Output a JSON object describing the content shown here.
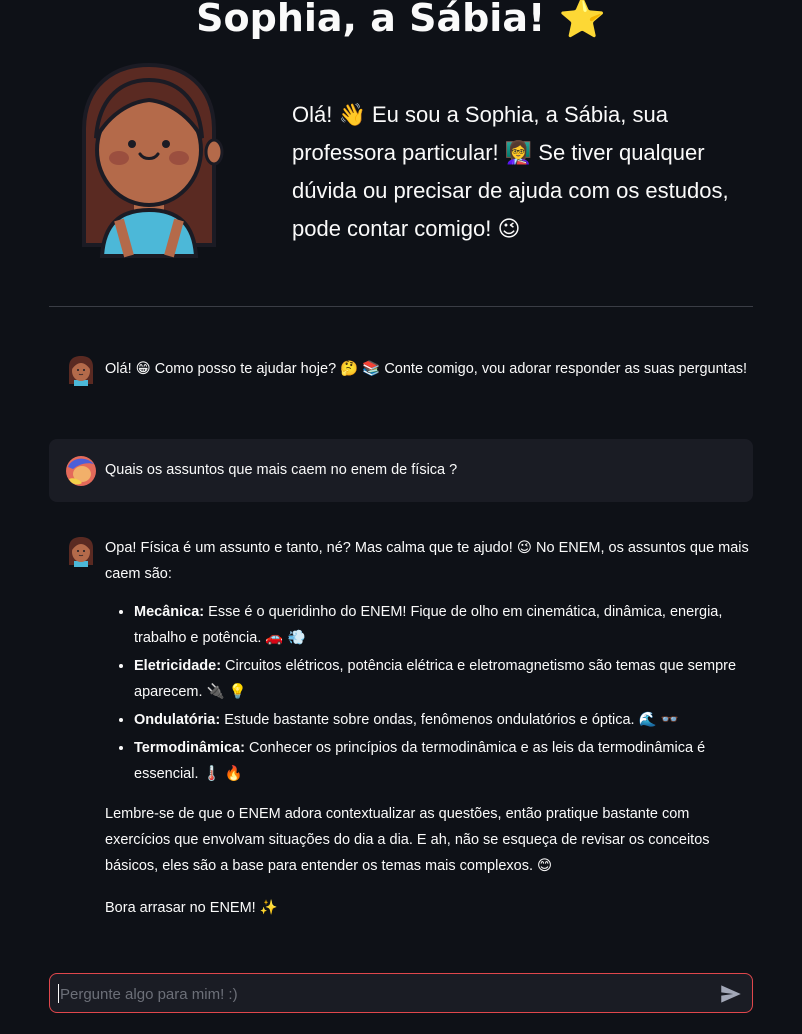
{
  "app": {
    "title": "Sophia, a Sábia! ⭐"
  },
  "intro": {
    "text": "Olá! 👋 Eu sou a Sophia, a Sábia, sua professora particular! 👩‍🏫 Se tiver qualquer dúvida ou precisar de ajuda com os estudos, pode contar comigo! 😉"
  },
  "chat": {
    "messages": [
      {
        "role": "assistant",
        "text": "Olá! 😁 Como posso te ajudar hoje? 🤔 📚 Conte comigo, vou adorar responder as suas perguntas!"
      },
      {
        "role": "user",
        "text": "Quais os assuntos que mais caem no enem de física ?"
      },
      {
        "role": "assistant",
        "intro": "Opa! Física é um assunto e tanto, né? Mas calma que te ajudo! 😉 No ENEM, os assuntos que mais caem são:",
        "items": [
          {
            "label": "Mecânica:",
            "text": " Esse é o queridinho do ENEM! Fique de olho em cinemática, dinâmica, energia, trabalho e potência. 🚗 💨"
          },
          {
            "label": "Eletricidade:",
            "text": " Circuitos elétricos, potência elétrica e eletromagnetismo são temas que sempre aparecem. 🔌 💡"
          },
          {
            "label": "Ondulatória:",
            "text": " Estude bastante sobre ondas, fenômenos ondulatórios e óptica. 🌊 👓"
          },
          {
            "label": "Termodinâmica:",
            "text": " Conhecer os princípios da termodinâmica e as leis da termodinâmica é essencial. 🌡️ 🔥"
          }
        ],
        "paragraph": "Lembre-se de que o ENEM adora contextualizar as questões, então pratique bastante com exercícios que envolvam situações do dia a dia. E ah, não se esqueça de revisar os conceitos básicos, eles são a base para entender os temas mais complexos. 😊",
        "closing": "Bora arrasar no ENEM! ✨"
      }
    ]
  },
  "input": {
    "placeholder": "Pergunte algo para mim! :)",
    "value": ""
  },
  "colors": {
    "background": "#0e1117",
    "user_bubble": "#1a1c24",
    "input_border": "#e0474c",
    "text": "#fafafa"
  },
  "icons": {
    "assistant_avatar": "girl-avatar-icon",
    "user_avatar": "user-avatar-icon",
    "send": "send-icon"
  }
}
